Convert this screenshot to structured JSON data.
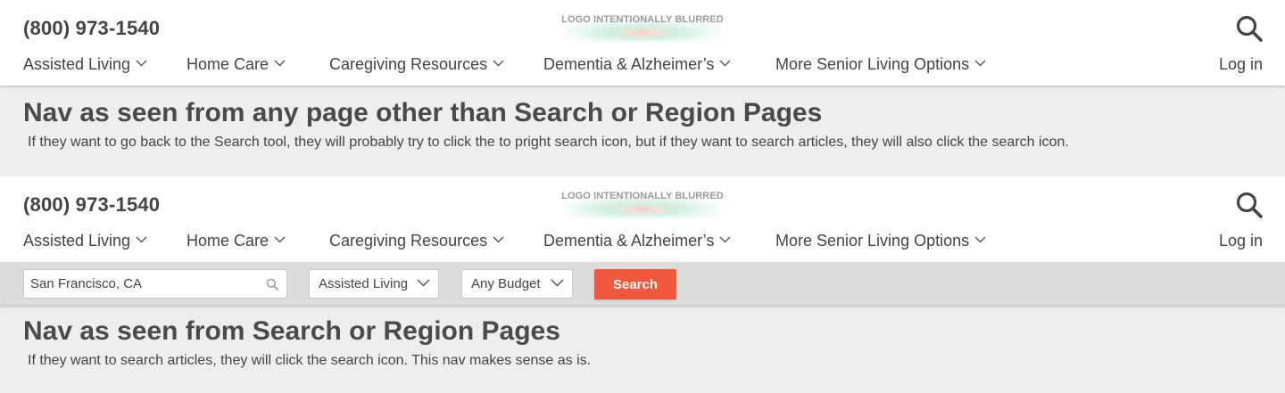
{
  "nav": {
    "phone": "(800) 973-1540",
    "logo_text": "LOGO INTENTIONALLY BLURRED",
    "menu": [
      {
        "label": "Assisted Living"
      },
      {
        "label": "Home Care"
      },
      {
        "label": "Caregiving Resources"
      },
      {
        "label": "Dementia & Alzheimer’s"
      },
      {
        "label": "More Senior Living Options"
      }
    ],
    "login_label": "Log in",
    "search_icon": "search-icon"
  },
  "note1": {
    "title": "Nav as seen from any page other than Search or Region Pages",
    "text": "If they want to go back to the Search tool, they will probably try to click the to pright search icon, but if they want to search articles, they will also click the search icon."
  },
  "search_bar": {
    "location_value": "San Francisco, CA",
    "care_type": "Assisted Living",
    "budget": "Any Budget",
    "button_label": "Search",
    "button_color": "#f2583e"
  },
  "note2": {
    "title": "Nav as seen from Search or Region Pages",
    "text": "If they want to search articles, they will click the search icon. This nav makes sense as is."
  }
}
